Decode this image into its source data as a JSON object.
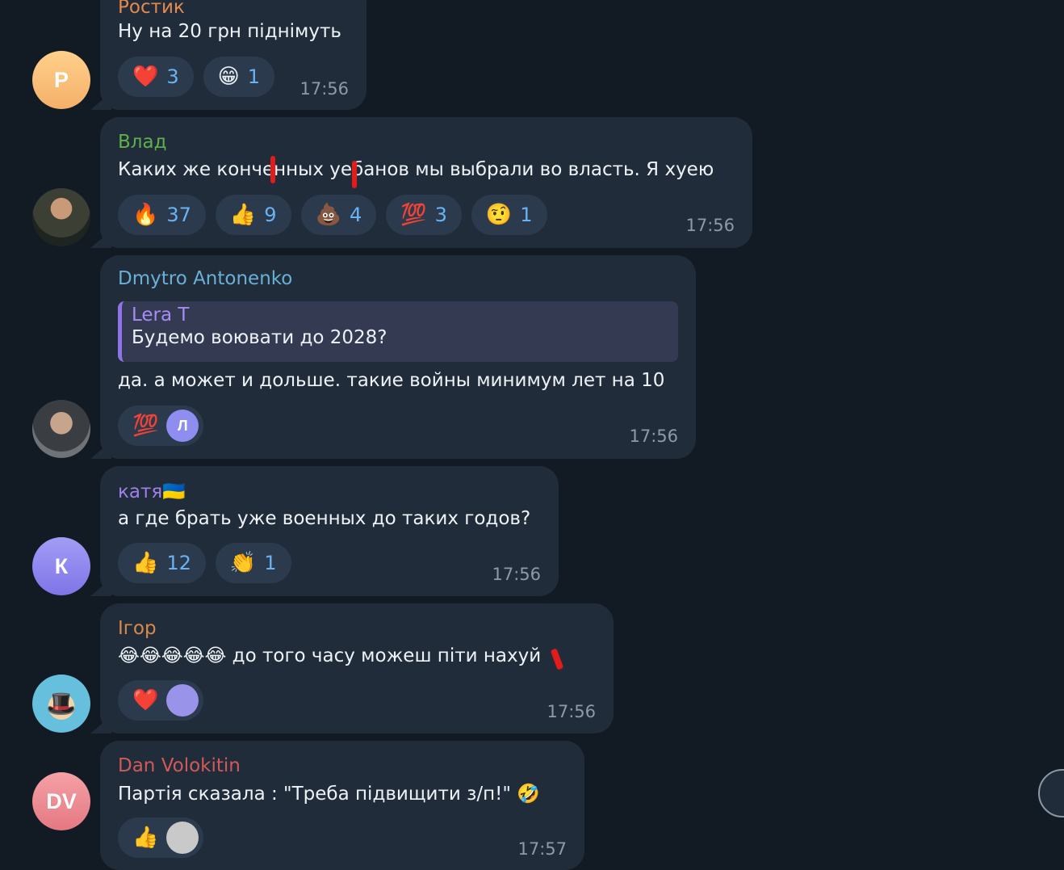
{
  "messages": [
    {
      "avatar": {
        "initials": "Р",
        "color": "#f6ba6f"
      },
      "sender": "Ростик",
      "sender_color": "#e5894c",
      "text": "Ну на 20 грн піднімуть",
      "reactions": [
        {
          "emoji": "❤️",
          "count": "3",
          "icon": "heart-icon"
        },
        {
          "emoji": "😁",
          "count": "1",
          "icon": "grin-face-icon"
        }
      ],
      "time": "17:56"
    },
    {
      "avatar": {
        "icon": "user-photo-avatar",
        "color": "#4b4a3c"
      },
      "sender": "Влад",
      "sender_color": "#5fb04d",
      "text": "Каких же конченных уебанов мы выбрали во власть. Я хуею",
      "reactions": [
        {
          "emoji": "🔥",
          "count": "37",
          "icon": "fire-icon"
        },
        {
          "emoji": "👍",
          "count": "9",
          "icon": "thumbs-up-icon"
        },
        {
          "emoji": "💩",
          "count": "4",
          "icon": "poop-icon"
        },
        {
          "emoji": "💯",
          "count": "3",
          "icon": "hundred-points-icon"
        },
        {
          "emoji": "🤨",
          "count": "1",
          "icon": "raised-eyebrow-icon"
        }
      ],
      "time": "17:56"
    },
    {
      "avatar": {
        "icon": "user-photo-avatar",
        "color": "#5d6066"
      },
      "sender": "Dmytro Antonenko",
      "sender_color": "#6ab0d6",
      "reply": {
        "author": "Lera T",
        "text": "Будемо воювати до 2028?"
      },
      "text": "да. а может и дольше. такие войны минимум лет на 10",
      "reactions": [
        {
          "emoji": "💯",
          "icon": "hundred-points-icon",
          "reactor": "Л",
          "reactor_color": "#8f8df0"
        }
      ],
      "time": "17:56"
    },
    {
      "avatar": {
        "initials": "К",
        "color": "#8e85f0"
      },
      "sender": "катя🇺🇦",
      "sender_color": "#a17fe8",
      "text": "а где брать уже военных до таких годов?",
      "reactions": [
        {
          "emoji": "👍",
          "count": "12",
          "icon": "thumbs-up-icon"
        },
        {
          "emoji": "👏",
          "count": "1",
          "icon": "clapping-hands-icon"
        }
      ],
      "time": "17:56"
    },
    {
      "avatar": {
        "icon": "cartoon-avatar",
        "color": "#5cb6d6"
      },
      "sender": "Ігор",
      "sender_color": "#d78a4c",
      "text": "😂😂😂😂😂 до того часу можеш піти нахуй",
      "reactions": [
        {
          "emoji": "❤️",
          "icon": "heart-icon",
          "reactor": "",
          "reactor_color": "#9a93ea"
        }
      ],
      "time": "17:56"
    },
    {
      "avatar": {
        "initials": "DV",
        "color": "#ee8a93"
      },
      "sender": "Dan Volokitin",
      "sender_color": "#d05a5a",
      "text": "Партія сказала : \"Треба підвищити з/п!\"  🤣",
      "reactions": [
        {
          "emoji": "👍",
          "icon": "thumbs-up-icon",
          "reactor": "",
          "reactor_color": "#c9c9c9"
        }
      ],
      "time": "17:57"
    }
  ]
}
